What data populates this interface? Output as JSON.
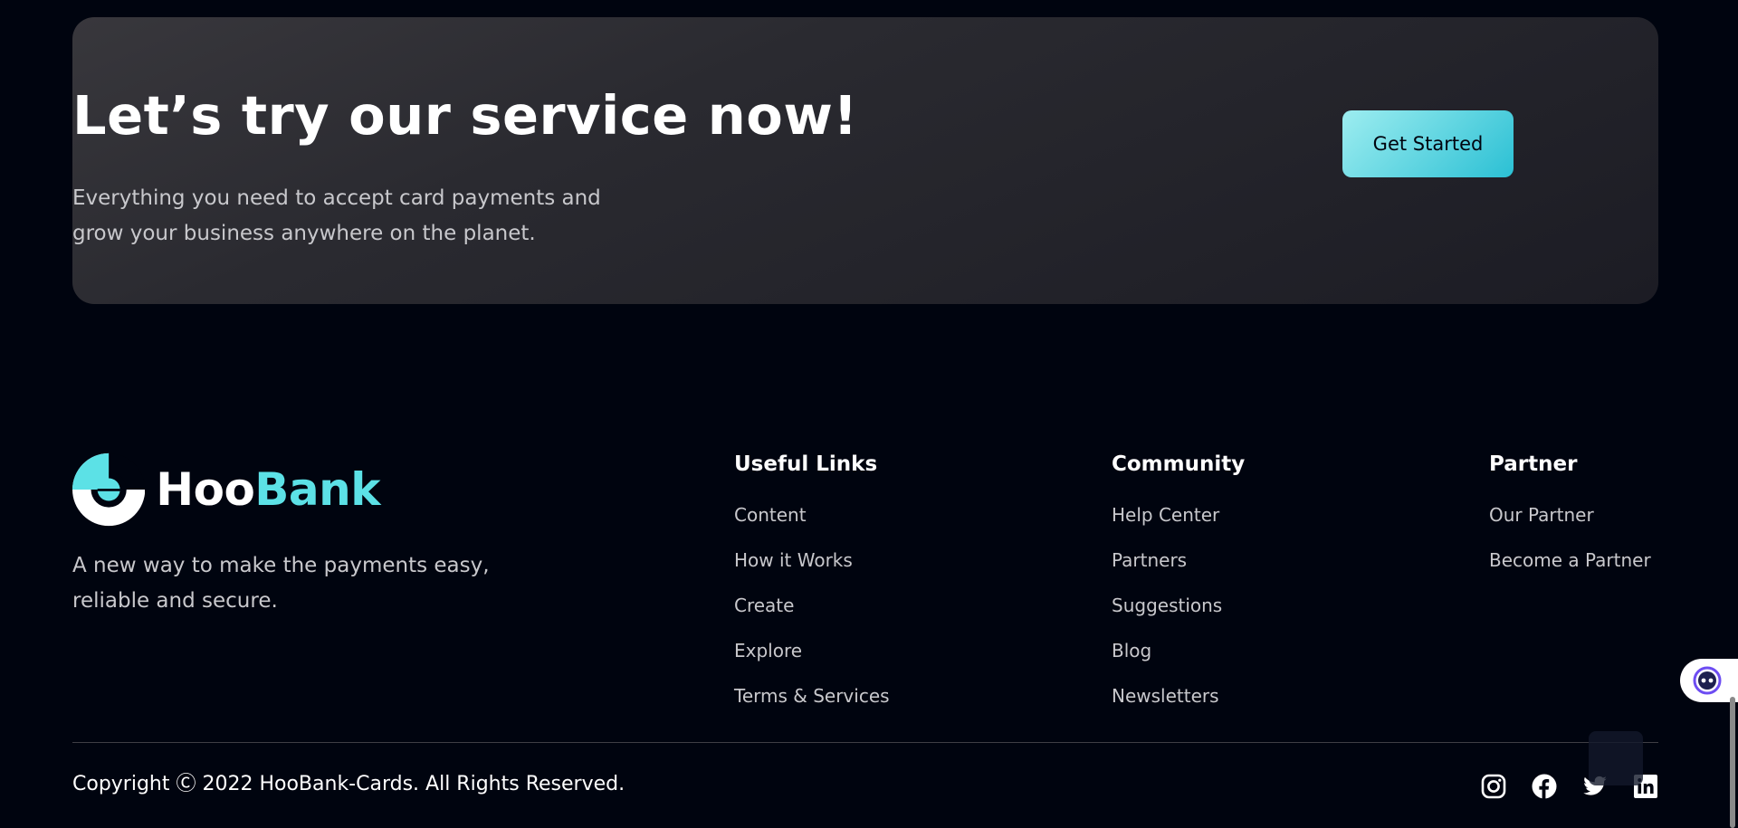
{
  "cta": {
    "title": "Let’s try our service now!",
    "text": "Everything you need to accept card payments and grow your business anywhere on the planet.",
    "button_label": "Get Started"
  },
  "footer": {
    "brand": {
      "name_part1": "Hoo",
      "name_part2": "Bank"
    },
    "tagline": "A new way to make the payments easy, reliable and secure.",
    "columns": [
      {
        "title": "Useful Links",
        "links": [
          "Content",
          "How it Works",
          "Create",
          "Explore",
          "Terms & Services"
        ]
      },
      {
        "title": "Community",
        "links": [
          "Help Center",
          "Partners",
          "Suggestions",
          "Blog",
          "Newsletters"
        ]
      },
      {
        "title": "Partner",
        "links": [
          "Our Partner",
          "Become a Partner"
        ]
      }
    ],
    "copyright": "Copyright Ⓒ 2022 HooBank-Cards. All Rights Reserved.",
    "social": [
      "instagram-icon",
      "facebook-icon",
      "twitter-icon",
      "linkedin-icon"
    ]
  },
  "colors": {
    "background": "#00040f",
    "accent": "#5ce1e6",
    "text_muted": "#c8c8cc"
  }
}
